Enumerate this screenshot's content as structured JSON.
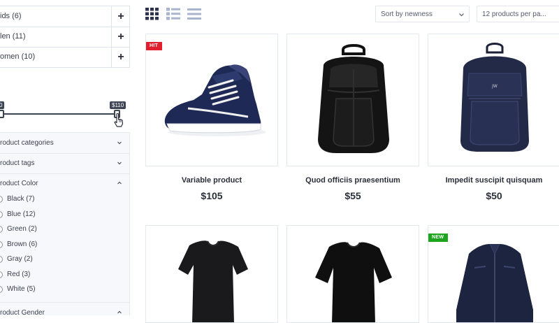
{
  "sidebar": {
    "categories": [
      {
        "label": "ids (6)"
      },
      {
        "label": "len (11)"
      },
      {
        "label": "omen (10)"
      }
    ],
    "price_filter": {
      "min_label": "0",
      "max_label": "$110"
    },
    "accordions": {
      "product_categories": "roduct categories",
      "product_tags": "roduct tags",
      "product_color": "roduct Color",
      "product_gender": "roduct Gender"
    },
    "colors": [
      {
        "label": "Black (7)"
      },
      {
        "label": "Blue (12)"
      },
      {
        "label": "Green (2)"
      },
      {
        "label": "Brown (6)"
      },
      {
        "label": "Gray (2)"
      },
      {
        "label": "Red (3)"
      },
      {
        "label": "White (5)"
      }
    ]
  },
  "toolbar": {
    "sort": {
      "selected": "Sort by newness"
    },
    "per_page": {
      "selected": "12 products per pa..."
    },
    "views": [
      "grid-view-icon",
      "list-view-icon",
      "compact-list-icon"
    ]
  },
  "products": [
    {
      "name": "Variable product",
      "price": "$105",
      "badge": "HIT",
      "image": "sneaker-image"
    },
    {
      "name": "Quod officiis praesentium",
      "price": "$55",
      "badge": "",
      "image": "black-backpack-image"
    },
    {
      "name": "Impedit suscipit quisquam",
      "price": "$50",
      "badge": "",
      "image": "navy-backpack-image"
    },
    {
      "name": "",
      "price": "",
      "badge": "",
      "image": "womens-tshirt-image"
    },
    {
      "name": "",
      "price": "",
      "badge": "",
      "image": "mens-tshirt-image"
    },
    {
      "name": "",
      "price": "",
      "badge": "NEW",
      "image": "navy-jacket-image"
    }
  ],
  "colors": {
    "accent": "#3d4454",
    "hit_badge": "#e0202e",
    "new_badge": "#1ea41e",
    "view_active": "#2b3350",
    "view_inactive": "#aab4cf"
  }
}
